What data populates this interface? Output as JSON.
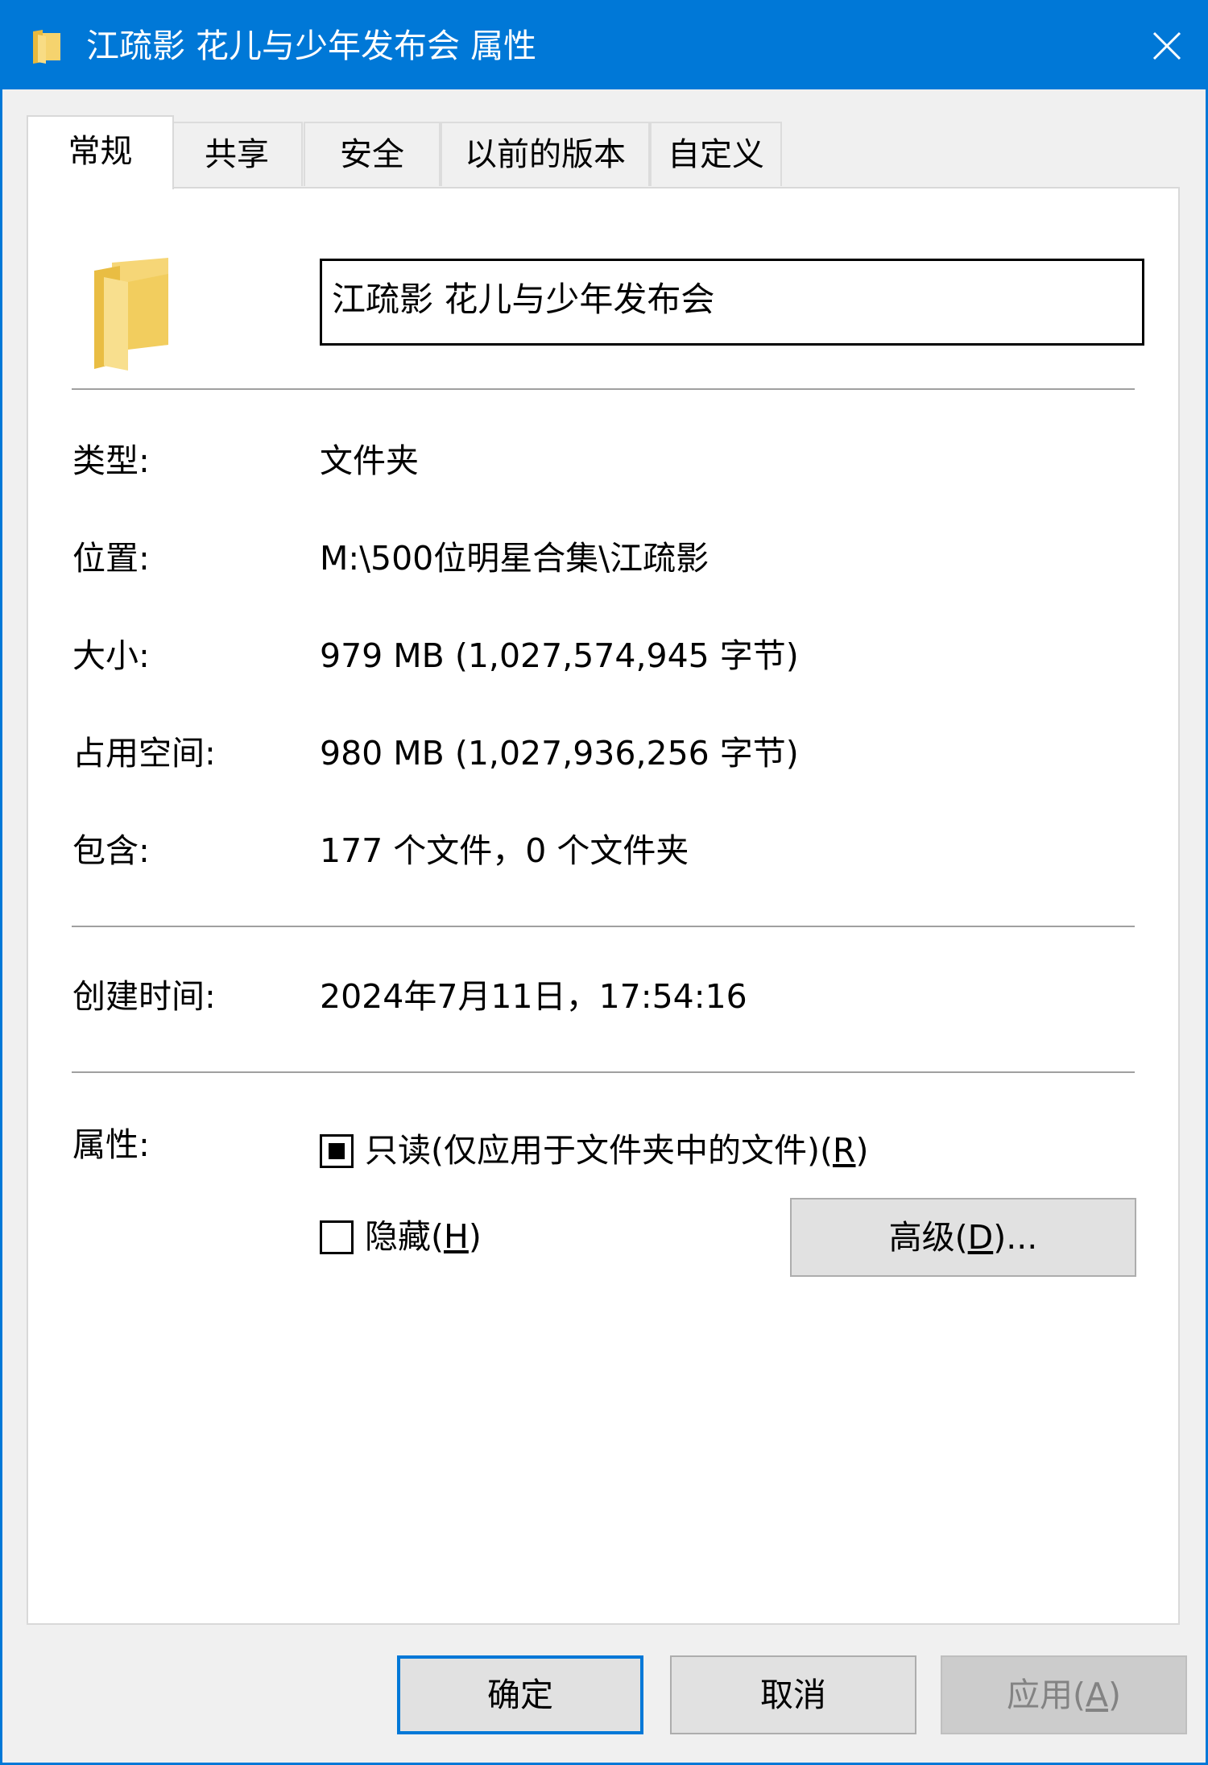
{
  "window": {
    "title": "江疏影 花儿与少年发布会 属性",
    "accent_color": "#0078d7",
    "title_icon": "folder-icon",
    "close_icon": "close-icon"
  },
  "tabs": [
    {
      "label": "常规",
      "active": true
    },
    {
      "label": "共享"
    },
    {
      "label": "安全"
    },
    {
      "label": "以前的版本"
    },
    {
      "label": "自定义"
    }
  ],
  "general": {
    "folder_icon": "folder-icon",
    "name_value": "江疏影 花儿与少年发布会",
    "fields": {
      "type": {
        "label": "类型:",
        "value": "文件夹"
      },
      "location": {
        "label": "位置:",
        "value": "M:\\500位明星合集\\江疏影"
      },
      "size": {
        "label": "大小:",
        "value": "979 MB (1,027,574,945 字节)"
      },
      "size_on_disk": {
        "label": "占用空间:",
        "value": "980 MB (1,027,936,256 字节)"
      },
      "contains": {
        "label": "包含:",
        "value": "177 个文件，0 个文件夹"
      },
      "created": {
        "label": "创建时间:",
        "value": "2024年7月11日，17:54:16"
      }
    },
    "attributes": {
      "label": "属性:",
      "readonly": {
        "text": "只读(仅应用于文件夹中的文件)(",
        "key": "R",
        "suffix": ")",
        "state": "indeterminate"
      },
      "hidden": {
        "text": "隐藏(",
        "key": "H",
        "suffix": ")",
        "state": "unchecked"
      },
      "advanced": {
        "text": "高级(",
        "key": "D",
        "suffix": ")..."
      }
    }
  },
  "buttons": {
    "ok": "确定",
    "cancel": "取消",
    "apply": {
      "text": "应用(",
      "key": "A",
      "suffix": ")",
      "enabled": false
    }
  }
}
